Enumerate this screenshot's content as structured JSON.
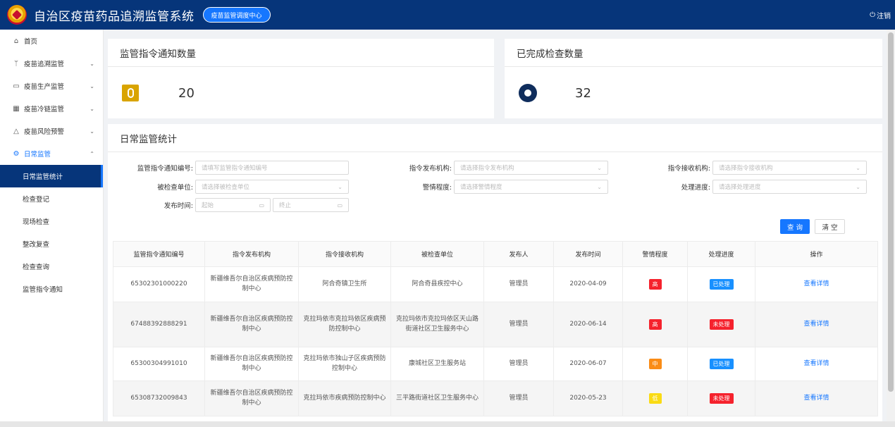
{
  "header": {
    "title": "自治区疫苗药品追溯监管系统",
    "center_label": "疫苗监管调度中心",
    "logout_label": "注销",
    "color": "#06357a"
  },
  "sidebar": {
    "items": [
      {
        "icon": "home-icon",
        "label": "首页"
      },
      {
        "icon": "branch-icon",
        "label": "疫苗追溯监管"
      },
      {
        "icon": "monitor-icon",
        "label": "疫苗生产监管"
      },
      {
        "icon": "grid-icon",
        "label": "疫苗冷链监管"
      },
      {
        "icon": "warning-icon",
        "label": "疫苗风险预警"
      },
      {
        "icon": "gear-icon",
        "label": "日常监管"
      }
    ],
    "sub_items": [
      "日常监管统计",
      "检查登记",
      "现场检查",
      "整改复查",
      "检查查询",
      "监管指令通知"
    ]
  },
  "stats": {
    "notices": {
      "title": "监管指令通知数量",
      "value": "20"
    },
    "checks": {
      "title": "已完成检查数量",
      "value": "32"
    }
  },
  "section": {
    "title": "日常监管统计"
  },
  "filters": {
    "notice_no": {
      "label": "监管指令通知编号:",
      "placeholder": "请填写监管指令通知编号"
    },
    "issuer": {
      "label": "指令发布机构:",
      "placeholder": "请选择指令发布机构"
    },
    "receiver": {
      "label": "指令接收机构:",
      "placeholder": "请选择指令接收机构"
    },
    "inspected": {
      "label": "被检查单位:",
      "placeholder": "请选择被检查单位"
    },
    "severity": {
      "label": "警情程度:",
      "placeholder": "请选择警情程度"
    },
    "progress": {
      "label": "处理进度:",
      "placeholder": "请选择处理进度"
    },
    "time": {
      "label": "发布时间:",
      "start": "起始",
      "end": "终止"
    }
  },
  "buttons": {
    "query": "查 询",
    "clear": "清 空"
  },
  "table": {
    "headers": [
      "监管指令通知编号",
      "指令发布机构",
      "指令接收机构",
      "被检查单位",
      "发布人",
      "发布时间",
      "警情程度",
      "处理进度",
      "操作"
    ],
    "rows": [
      {
        "no": "65302301000220",
        "issuer": "新疆维吾尔自治区疾病预防控制中心",
        "receiver": "阿合奇镇卫生所",
        "inspected": "阿合奇县疾控中心",
        "publisher": "管理员",
        "date": "2020-04-09",
        "severity": "高",
        "severity_color": "#f5222d",
        "status": "已处理",
        "status_color": "#1890ff",
        "action": "查看详情"
      },
      {
        "no": "67488392888291",
        "issuer": "新疆维吾尔自治区疾病预防控制中心",
        "receiver": "克拉玛依市克拉玛依区疾病预防控制中心",
        "inspected": "克拉玛依市克拉玛依区天山路街道社区卫生服务中心",
        "publisher": "管理员",
        "date": "2020-06-14",
        "severity": "高",
        "severity_color": "#f5222d",
        "status": "未处理",
        "status_color": "#f5222d",
        "action": "查看详情"
      },
      {
        "no": "65300304991010",
        "issuer": "新疆维吾尔自治区疾病预防控制中心",
        "receiver": "克拉玛依市独山子区疾病预防控制中心",
        "inspected": "康城社区卫生服务站",
        "publisher": "管理员",
        "date": "2020-06-07",
        "severity": "中",
        "severity_color": "#fa8c16",
        "status": "已处理",
        "status_color": "#1890ff",
        "action": "查看详情"
      },
      {
        "no": "65308732009843",
        "issuer": "新疆维吾尔自治区疾病预防控制中心",
        "receiver": "克拉玛依市疾病预防控制中心",
        "inspected": "三平路街道社区卫生服务中心",
        "publisher": "管理员",
        "date": "2020-05-23",
        "severity": "低",
        "severity_color": "#fadb14",
        "status": "未处理",
        "status_color": "#f5222d",
        "action": "查看详情"
      }
    ]
  }
}
